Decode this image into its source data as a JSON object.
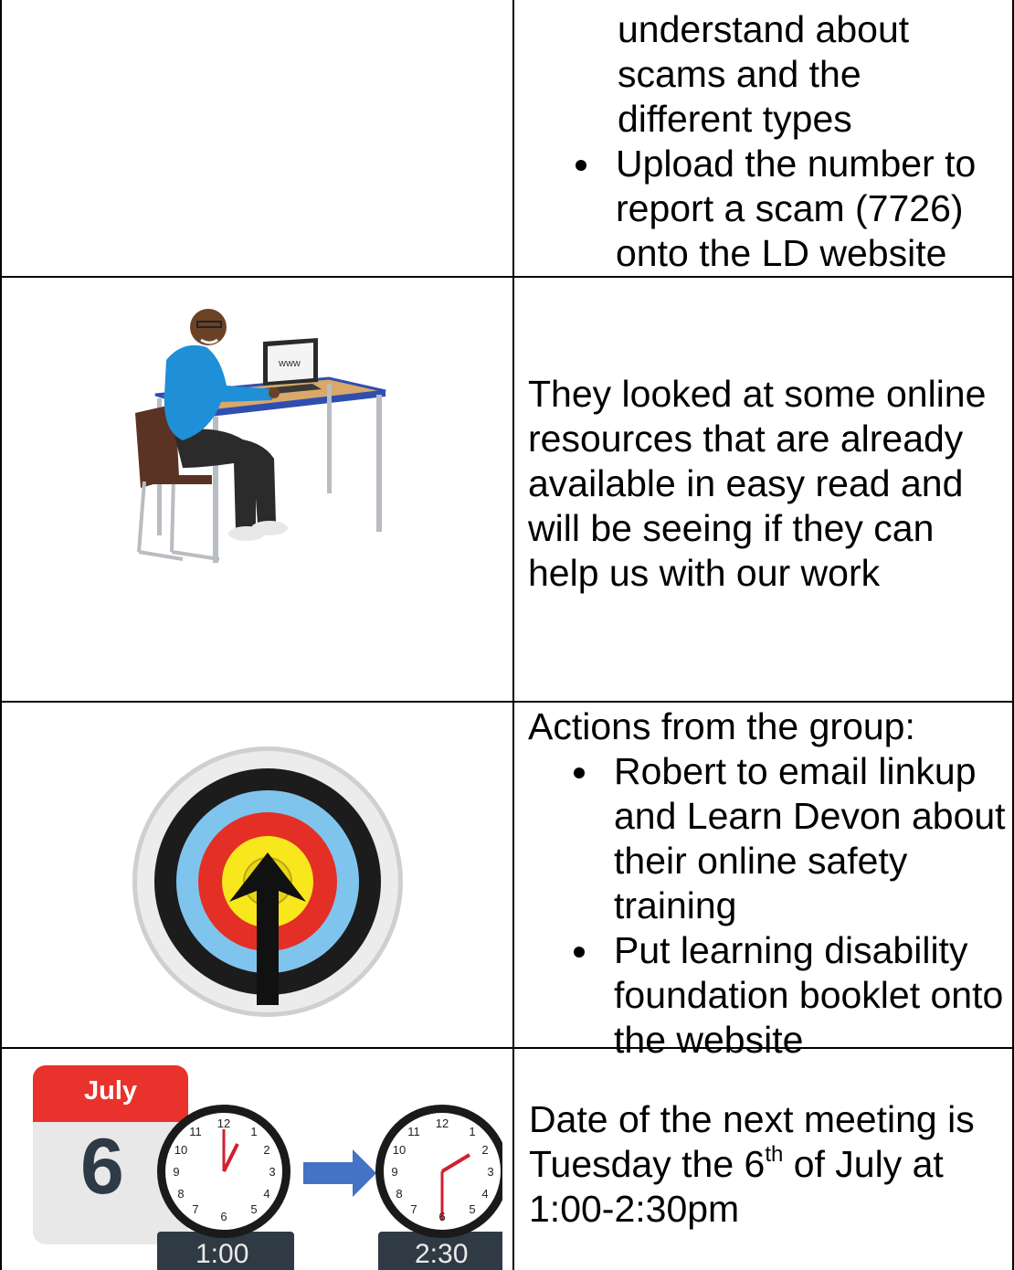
{
  "rows": [
    {
      "continued_text": [
        "understand about",
        "scams and the",
        "different types"
      ],
      "bullets": [
        "Upload the number to report a scam (7726) onto the LD website"
      ]
    },
    {
      "image": {
        "icon": "person-at-laptop-icon",
        "screen_text": "www"
      },
      "text": "They looked at some online resources that are already available in easy read and will be seeing if they can help us with our work"
    },
    {
      "image": {
        "icon": "target-with-arrow-icon"
      },
      "heading": "Actions from the group:",
      "bullets": [
        "Robert to email linkup and Learn Devon about their online safety training",
        "Put learning disability foundation booklet onto the website"
      ]
    },
    {
      "image": {
        "icon": "calendar-clocks-icon",
        "calendar_month": "July",
        "calendar_day": "6",
        "start_time": "1:00",
        "end_time": "2:30"
      },
      "text_before_sup": "Date of the next meeting is Tuesday the 6",
      "sup": "th",
      "text_after_sup": " of July at 1:00-2:30pm"
    }
  ],
  "colors": {
    "calendar_red": "#e8322b",
    "shirt_blue": "#1f8fd8",
    "target_blue": "#7fc4ec",
    "target_red": "#e42f26",
    "target_yellow": "#f8e71c",
    "arrow_blue": "#4472c4",
    "clock_display": "#2f3a45"
  }
}
